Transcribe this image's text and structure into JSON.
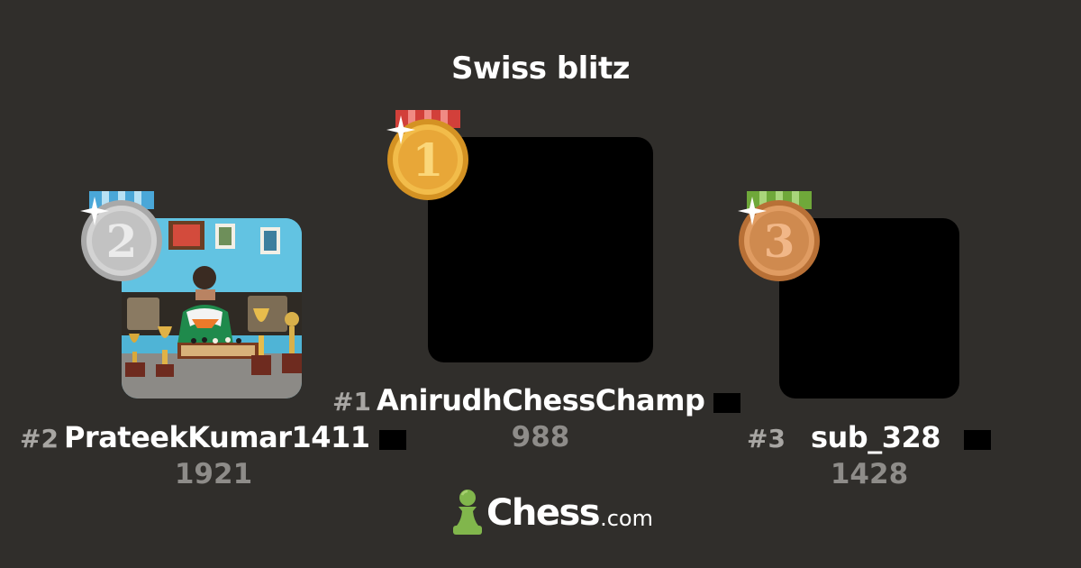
{
  "tournament": {
    "title": "Swiss blitz"
  },
  "podium": {
    "first": {
      "rank": "#1",
      "username": "AnirudhChessChamp",
      "rating": "988",
      "medal_numeral": "1",
      "medal": "gold-medal-icon"
    },
    "second": {
      "rank": "#2",
      "username": "PrateekKumar1411",
      "rating": "1921",
      "medal_numeral": "2",
      "medal": "silver-medal-icon"
    },
    "third": {
      "rank": "#3",
      "username": "sub_328",
      "rating": "1428",
      "medal_numeral": "3",
      "medal": "bronze-medal-icon"
    }
  },
  "brand": {
    "name": "Chess",
    "tld": ".com",
    "logo": "pawn-icon",
    "accent": "#81b64c"
  },
  "colors": {
    "background": "#302e2b",
    "gold": "#e8a738",
    "silver": "#c9c9c9",
    "bronze": "#cf8a4f"
  }
}
